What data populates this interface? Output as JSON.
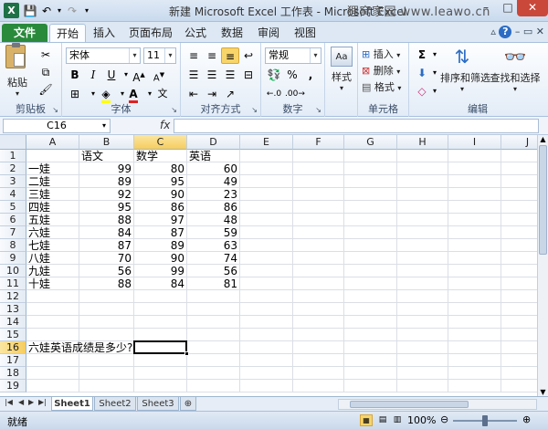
{
  "titlebar": {
    "app_letter": "X",
    "title": "新建 Microsoft Excel 工作表 - Microsoft Excel",
    "watermark": "狸窝家园 www.leawo.cn",
    "minimize": "–",
    "restore": "□",
    "close": "✕"
  },
  "tabs": [
    "文件",
    "开始",
    "插入",
    "页面布局",
    "公式",
    "数据",
    "审阅",
    "视图"
  ],
  "ribbon": {
    "clipboard": {
      "paste": "粘贴",
      "label": "剪贴板"
    },
    "font": {
      "name": "宋体",
      "size": "11",
      "label": "字体"
    },
    "alignment": {
      "label": "对齐方式"
    },
    "number": {
      "format": "常规",
      "label": "数字"
    },
    "styles": {
      "styles_btn": "样式"
    },
    "cells": {
      "insert": "插入",
      "delete": "删除",
      "format": "格式",
      "label": "单元格"
    },
    "editing": {
      "sort_filter": "排序和筛选",
      "find_select": "查找和选择",
      "label": "编辑"
    }
  },
  "formula_bar": {
    "name_box": "C16",
    "fx": "fx",
    "value": ""
  },
  "columns": [
    "A",
    "B",
    "C",
    "D",
    "E",
    "F",
    "G",
    "H",
    "I",
    "J"
  ],
  "rows": [
    "1",
    "2",
    "3",
    "4",
    "5",
    "6",
    "7",
    "8",
    "9",
    "10",
    "11",
    "12",
    "13",
    "14",
    "15",
    "16",
    "17",
    "18",
    "19"
  ],
  "cells": {
    "header": [
      "",
      "语文",
      "数学",
      "英语"
    ],
    "data": [
      [
        "一娃",
        "99",
        "80",
        "60"
      ],
      [
        "二娃",
        "89",
        "95",
        "49"
      ],
      [
        "三娃",
        "92",
        "90",
        "23"
      ],
      [
        "四娃",
        "95",
        "86",
        "86"
      ],
      [
        "五娃",
        "88",
        "97",
        "48"
      ],
      [
        "六娃",
        "84",
        "87",
        "59"
      ],
      [
        "七娃",
        "87",
        "89",
        "63"
      ],
      [
        "八娃",
        "70",
        "90",
        "74"
      ],
      [
        "九娃",
        "56",
        "99",
        "56"
      ],
      [
        "十娃",
        "88",
        "84",
        "81"
      ]
    ],
    "a16": "六娃英语成绩是多少?"
  },
  "sheets": [
    "Sheet1",
    "Sheet2",
    "Sheet3"
  ],
  "status": {
    "ready": "就绪",
    "zoom": "100%"
  }
}
